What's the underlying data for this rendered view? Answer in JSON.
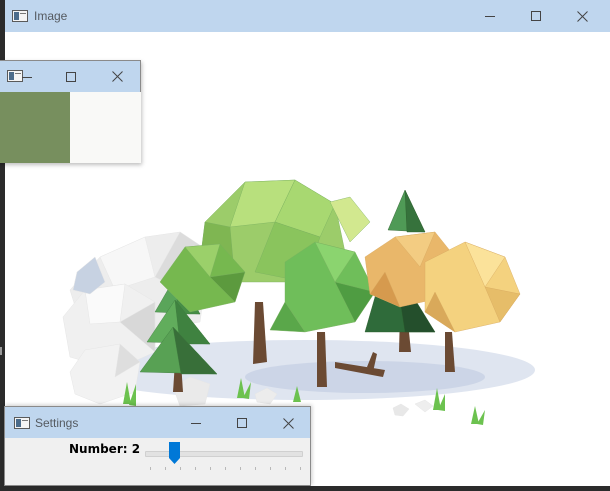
{
  "image_window": {
    "title": "Image",
    "icon": "window-app-icon",
    "controls": [
      "minimize-icon",
      "maximize-icon",
      "close-icon"
    ],
    "content": "low-poly forest illustration with rocks, trees and grass"
  },
  "color_window": {
    "title": "",
    "icon": "window-app-icon",
    "controls": [
      "minimize-icon",
      "maximize-icon",
      "close-icon"
    ],
    "swatch_left_color": "#778f5e",
    "swatch_right_color": "#f9f9f7"
  },
  "settings_window": {
    "title": "Settings",
    "icon": "window-app-icon",
    "controls": [
      "minimize-icon",
      "maximize-icon",
      "close-icon"
    ],
    "number_label": "Number: 2",
    "slider": {
      "value": 2,
      "min": 0,
      "max": 10,
      "accent": "#0078d7"
    }
  },
  "colors": {
    "titlebar": "#bfd6ee",
    "slider_accent": "#0078d7"
  }
}
